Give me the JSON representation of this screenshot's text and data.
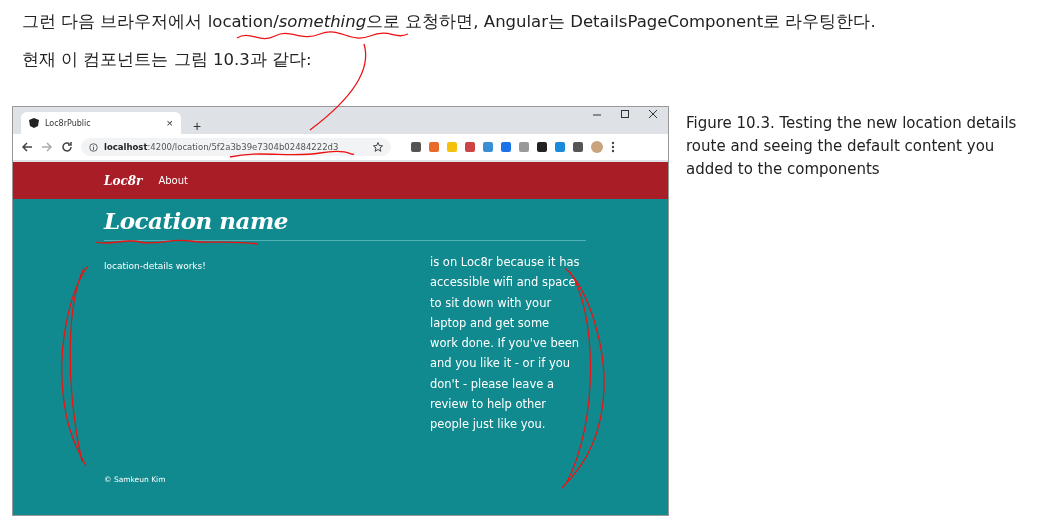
{
  "intro": [
    [
      {
        "text": "그런 다음 브라우저에서 location/",
        "italic": false
      },
      {
        "text": "something",
        "italic": true
      },
      {
        "text": "으로 요청하면, Angular는 DetailsPageComponent로 라우팅한다.",
        "italic": false
      }
    ],
    [
      {
        "text": "현재 이 컴포넌트는 그림 10.3과 같다:",
        "italic": false
      }
    ]
  ],
  "browser": {
    "tab": {
      "title": "Loc8rPublic",
      "close": "×",
      "selected": true
    },
    "new_tab": "+",
    "url": "**localhost**:4200/location/5f2a3b39e7304b02484222d3"
  },
  "site": {
    "brand": "Loc8r",
    "nav": [
      {
        "label": "About"
      }
    ],
    "heading": "Location name",
    "main_text": "location-details works!",
    "sidebar_text": "is on Loc8r because it has accessible wifi and space to sit down with your laptop and get some work done. If you've been and you like it - or if you don't - please leave a review to help other people just like you.",
    "footer": "© Samkeun Kim"
  },
  "caption": "Figure 10.3. Testing the new location details route and seeing the default content you added to the components"
}
